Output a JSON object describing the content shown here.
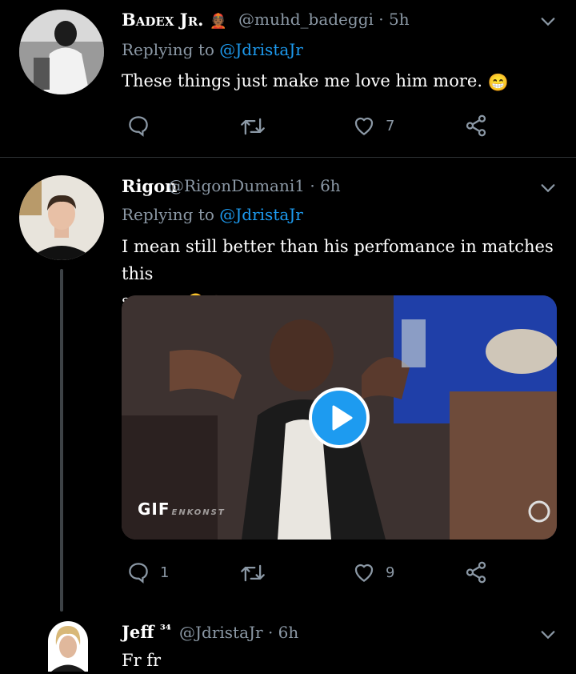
{
  "tweets": [
    {
      "name": "Badex Jr.",
      "name_emoji": "👲🏾",
      "handle": "@muhd_badeggi",
      "time": "· 5h",
      "replying_prefix": "Replying to",
      "replying_to": "@JdristaJr",
      "text": "These things just make me love him more.",
      "text_emoji": "😁",
      "reply_count": "",
      "retweet_count": "",
      "like_count": "7"
    },
    {
      "name": "Rigon",
      "handle": "@RigonDumani1",
      "time": "· 6h",
      "replying_prefix": "Replying to",
      "replying_to": "@JdristaJr",
      "text_line1": "I mean still better than his perfomance in matches this",
      "text_line2": "season",
      "text_emoji": "🤣🙈",
      "media_badge": "GIF",
      "media_watermark": "ENKONST",
      "reply_count": "1",
      "retweet_count": "",
      "like_count": "9"
    },
    {
      "name": "Jeff",
      "name_suffix": "³⁴",
      "handle": "@JdristaJr",
      "time": "· 6h",
      "text": "Fr fr"
    }
  ],
  "icons": {
    "reply": "reply-icon",
    "retweet": "retweet-icon",
    "like": "heart-icon",
    "share": "share-icon",
    "more": "chevron-down-icon",
    "play": "play-icon"
  },
  "colors": {
    "background": "#000000",
    "secondary_text": "#8b98a5",
    "link": "#1d9bf0",
    "divider": "#2f3336"
  }
}
